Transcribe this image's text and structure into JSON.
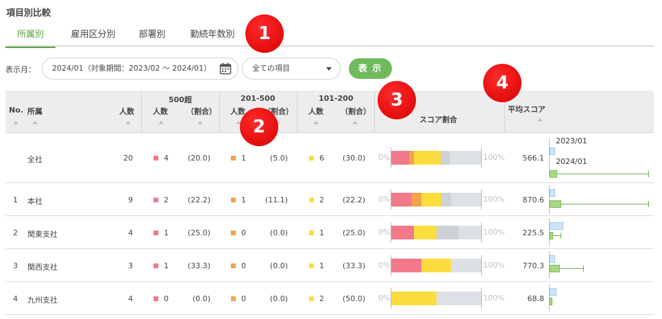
{
  "page": {
    "title": "項目別比較"
  },
  "tabs": [
    {
      "label": "所属別",
      "active": true
    },
    {
      "label": "雇用区分別",
      "active": false
    },
    {
      "label": "部署別",
      "active": false
    },
    {
      "label": "勤続年数別",
      "active": false
    }
  ],
  "badges": [
    "1",
    "2",
    "3",
    "4"
  ],
  "filters": {
    "month_label": "表示月：",
    "date_value": "2024/01（対象期間：2023/02 ～ 2024/01）",
    "select_value": "全ての項目",
    "show_button": "表 示"
  },
  "table": {
    "headers": {
      "no": "No.",
      "dept": "所属",
      "headcount": "人数",
      "group1": "500超",
      "group2": "201-500",
      "group3": "101-200",
      "sub_count": "人数",
      "sub_ratio": "（割合）",
      "score_ratio": "スコア割合",
      "avg_score": "平均スコア"
    },
    "bar_scale": {
      "min_label": "0%",
      "max_label": "100%"
    },
    "avg_legend": {
      "prev": "2023/01",
      "curr": "2024/01"
    },
    "rows": [
      {
        "no": "",
        "dept": "全社",
        "headcount": "20",
        "g1_count": "4",
        "g1_ratio": "(20.0)",
        "g2_count": "1",
        "g2_ratio": "(5.0)",
        "g3_count": "6",
        "g3_ratio": "(30.0)",
        "avg": "566.1",
        "bar": {
          "pink": 20.0,
          "orange": 5.0,
          "yellow": 30.0,
          "gray": 10.0
        }
      },
      {
        "no": "1",
        "dept": "本社",
        "headcount": "9",
        "g1_count": "2",
        "g1_ratio": "(22.2)",
        "g2_count": "1",
        "g2_ratio": "(11.1)",
        "g3_count": "2",
        "g3_ratio": "(22.2)",
        "avg": "870.6",
        "bar": {
          "pink": 22.2,
          "orange": 11.1,
          "yellow": 22.2,
          "gray": 11.1
        }
      },
      {
        "no": "2",
        "dept": "関東支社",
        "headcount": "4",
        "g1_count": "1",
        "g1_ratio": "(25.0)",
        "g2_count": "0",
        "g2_ratio": "(0.0)",
        "g3_count": "1",
        "g3_ratio": "(25.0)",
        "avg": "225.5",
        "bar": {
          "pink": 25.0,
          "orange": 0.0,
          "yellow": 25.0,
          "gray": 25.0
        }
      },
      {
        "no": "3",
        "dept": "関西支社",
        "headcount": "3",
        "g1_count": "1",
        "g1_ratio": "(33.3)",
        "g2_count": "0",
        "g2_ratio": "(0.0)",
        "g3_count": "1",
        "g3_ratio": "(33.3)",
        "avg": "770.3",
        "bar": {
          "pink": 33.3,
          "orange": 0.0,
          "yellow": 33.3,
          "gray": 0.0
        }
      },
      {
        "no": "4",
        "dept": "九州支社",
        "headcount": "4",
        "g1_count": "0",
        "g1_ratio": "(0.0)",
        "g2_count": "0",
        "g2_ratio": "(0.0)",
        "g3_count": "2",
        "g3_ratio": "(50.0)",
        "avg": "68.8",
        "bar": {
          "pink": 0.0,
          "orange": 0.0,
          "yellow": 50.0,
          "gray": 0.0
        }
      }
    ]
  },
  "colors": {
    "accent": "#5aa33c",
    "button": "#6fba5c",
    "pink": "#f2788a",
    "orange": "#f2a34b",
    "yellow": "#fbdd3f",
    "gray": "#ccd1d6",
    "rest": "#dde1e5"
  },
  "icons": {
    "date_field": "calendar-icon",
    "select": "caret-down-icon",
    "sort": "sort-asc-icon"
  }
}
